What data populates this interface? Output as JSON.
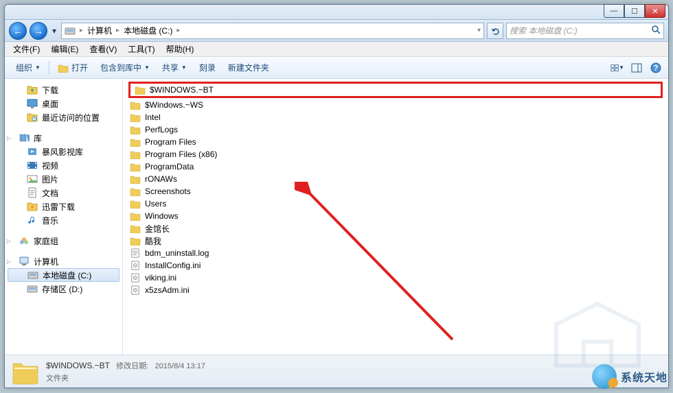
{
  "window": {
    "controls": {
      "min": "—",
      "max": "☐",
      "close": "✕"
    }
  },
  "nav": {
    "breadcrumb": [
      "计算机",
      "本地磁盘 (C:)"
    ],
    "search_placeholder": "搜索 本地磁盘 (C:)"
  },
  "menu": {
    "file": "文件(F)",
    "edit": "编辑(E)",
    "view": "查看(V)",
    "tools": "工具(T)",
    "help": "帮助(H)"
  },
  "toolbar": {
    "organize": "组织",
    "open": "打开",
    "include": "包含到库中",
    "share": "共享",
    "burn": "刻录",
    "newfolder": "新建文件夹"
  },
  "sidebar": {
    "favs": [
      {
        "icon": "download",
        "label": "下载"
      },
      {
        "icon": "desktop",
        "label": "桌面"
      },
      {
        "icon": "recent",
        "label": "最近访问的位置"
      }
    ],
    "libs_header": "库",
    "libs": [
      {
        "icon": "video-lib",
        "label": "暴风影视库"
      },
      {
        "icon": "video",
        "label": "视频"
      },
      {
        "icon": "pictures",
        "label": "图片"
      },
      {
        "icon": "documents",
        "label": "文档"
      },
      {
        "icon": "thunder",
        "label": "迅雷下载"
      },
      {
        "icon": "music",
        "label": "音乐"
      }
    ],
    "homegroup": "家庭组",
    "computer": "计算机",
    "drives": [
      {
        "icon": "drive-c",
        "label": "本地磁盘 (C:)",
        "active": true
      },
      {
        "icon": "drive-d",
        "label": "存储区 (D:)",
        "active": false
      }
    ]
  },
  "files": [
    {
      "type": "folder",
      "name": "$WINDOWS.~BT",
      "highlight": true
    },
    {
      "type": "folder",
      "name": "$Windows.~WS"
    },
    {
      "type": "folder",
      "name": "Intel"
    },
    {
      "type": "folder",
      "name": "PerfLogs"
    },
    {
      "type": "folder",
      "name": "Program Files"
    },
    {
      "type": "folder",
      "name": "Program Files (x86)"
    },
    {
      "type": "folder",
      "name": "ProgramData"
    },
    {
      "type": "folder",
      "name": "rONAWs"
    },
    {
      "type": "folder",
      "name": "Screenshots"
    },
    {
      "type": "folder",
      "name": "Users"
    },
    {
      "type": "folder",
      "name": "Windows"
    },
    {
      "type": "folder",
      "name": "金馆长"
    },
    {
      "type": "folder",
      "name": "酷我"
    },
    {
      "type": "log",
      "name": "bdm_uninstall.log"
    },
    {
      "type": "ini",
      "name": "InstallConfig.ini"
    },
    {
      "type": "ini",
      "name": "viking.ini"
    },
    {
      "type": "ini",
      "name": "x5zsAdm.ini"
    }
  ],
  "footer": {
    "name": "$WINDOWS.~BT",
    "mod_label": "修改日期:",
    "mod_date": "2015/8/4 13:17",
    "type": "文件夹"
  },
  "watermark": "系统天地"
}
